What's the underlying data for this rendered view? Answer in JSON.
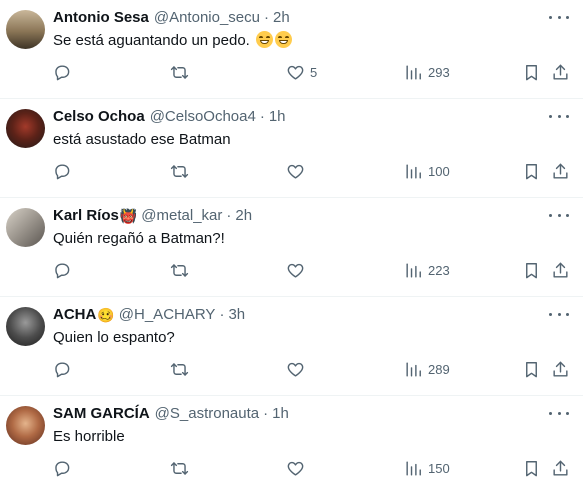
{
  "replies": [
    {
      "name": "Antonio Sesa",
      "badge": "",
      "handle": "@Antonio_secu",
      "time": "2h",
      "text": "Se está aguantando un pedo.",
      "emojis": 2,
      "likes": "5",
      "views": "293"
    },
    {
      "name": "Celso Ochoa",
      "badge": "",
      "handle": "@CelsoOchoa4",
      "time": "1h",
      "text": "está asustado ese Batman",
      "emojis": 0,
      "likes": "",
      "views": "100"
    },
    {
      "name": "Karl Ríos",
      "badge": "👹",
      "handle": "@metal_kar",
      "time": "2h",
      "text": "Quién regañó a Batman?!",
      "emojis": 0,
      "likes": "",
      "views": "223"
    },
    {
      "name": "ACHA",
      "badge": "🥴",
      "handle": "@H_ACHARY",
      "time": "3h",
      "text": "Quien lo espanto?",
      "emojis": 0,
      "likes": "",
      "views": "289"
    },
    {
      "name": "SAM GARCÍA",
      "badge": "",
      "handle": "@S_astronauta",
      "time": "1h",
      "text": "Es horrible",
      "emojis": 0,
      "likes": "",
      "views": "150"
    }
  ],
  "separator": "·",
  "colors": {
    "text": "#0f1419",
    "muted": "#536471",
    "divider": "#eff3f4"
  },
  "icons": [
    "reply-icon",
    "retweet-icon",
    "like-icon",
    "views-icon",
    "bookmark-icon",
    "share-icon",
    "more-icon"
  ]
}
